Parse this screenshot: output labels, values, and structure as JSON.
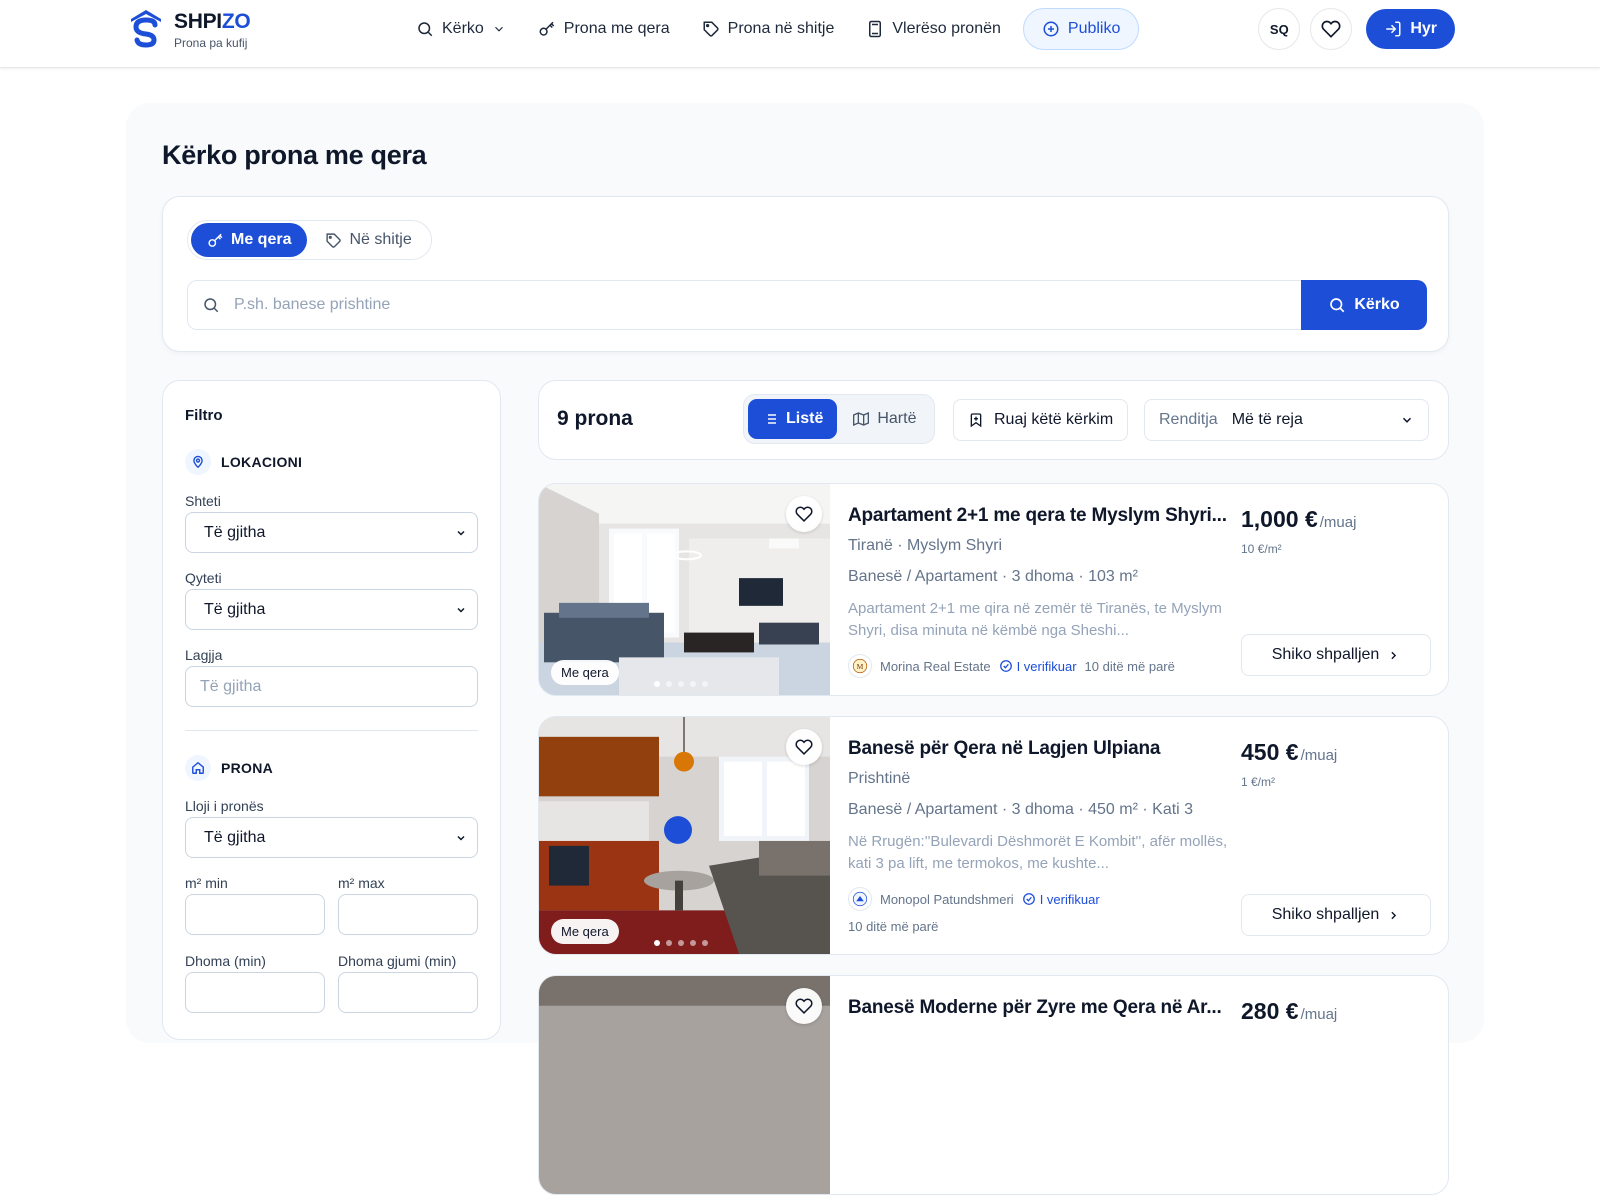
{
  "brand": {
    "name_main": "SHPI",
    "name_accent": "ZO",
    "tagline": "Prona pa kufij"
  },
  "nav": {
    "search": "Kërko",
    "rent": "Prona me qera",
    "sale": "Prona në shitje",
    "valuate": "Vlerëso pronën",
    "publish": "Publiko"
  },
  "header": {
    "language": "SQ",
    "login": "Hyr"
  },
  "page": {
    "title": "Kërko prona me qera"
  },
  "search": {
    "mode_rent": "Me qera",
    "mode_sale": "Në shitje",
    "placeholder": "P.sh. banese prishtine",
    "button": "Kërko"
  },
  "filters": {
    "title": "Filtro",
    "location_heading": "LOKACIONI",
    "country_label": "Shteti",
    "country_value": "Të gjitha",
    "city_label": "Qyteti",
    "city_value": "Të gjitha",
    "neighborhood_label": "Lagjja",
    "neighborhood_placeholder": "Të gjitha",
    "property_heading": "PRONA",
    "type_label": "Lloji i pronës",
    "type_value": "Të gjitha",
    "sqm_min_label": "m² min",
    "sqm_max_label": "m² max",
    "rooms_min_label": "Dhoma (min)",
    "bedrooms_min_label": "Dhoma gjumi (min)"
  },
  "results": {
    "count": "9 prona",
    "view_list": "Listë",
    "view_map": "Hartë",
    "save_search": "Ruaj këtë kërkim",
    "sort_label": "Renditja",
    "sort_value": "Më të reja"
  },
  "listings": [
    {
      "title": "Apartament 2+1 me qera te Myslym Shyri...",
      "location": "Tiranë · Myslym Shyri",
      "specs": "Banesë / Apartament · 3 dhoma · 103 m²",
      "description": "Apartament 2+1 me qira në zemër të Tiranës, te Myslym Shyri, disa minuta në këmbë nga Sheshi...",
      "agency": "Morina Real Estate",
      "verified": "I verifikuar",
      "posted": "10 ditë më parë",
      "price": "1,000 €",
      "price_unit": "/muaj",
      "price_per_sqm": "10 €/m²",
      "badge": "Me qera",
      "cta": "Shiko shpalljen"
    },
    {
      "title": "Banesë për Qera në Lagjen Ulpiana",
      "location": "Prishtinë",
      "specs": "Banesë / Apartament · 3 dhoma · 450 m² · Kati 3",
      "description": "Në Rrugën:''Bulevardi Dëshmorët E Kombit'', afër mollës, kati 3 pa lift, me termokos, me kushte...",
      "agency": "Monopol Patundshmeri",
      "verified": "I verifikuar",
      "posted": "10 ditë më parë",
      "price": "450 €",
      "price_unit": "/muaj",
      "price_per_sqm": "1 €/m²",
      "badge": "Me qera",
      "cta": "Shiko shpalljen"
    },
    {
      "title": "Banesë Moderne për Zyre me Qera në Ar...",
      "price": "280 €",
      "price_unit": "/muaj"
    }
  ],
  "colors": {
    "primary": "#1d4ed8",
    "panel_bg": "#f8fafc",
    "border": "#e2e8f0",
    "muted": "#64748b"
  }
}
